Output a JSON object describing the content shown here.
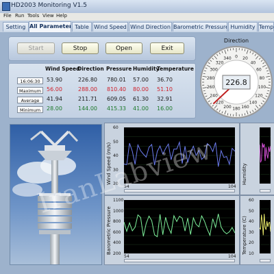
{
  "window": {
    "title": "HD2003 Monitoring V1.5"
  },
  "menu": [
    "File",
    "Run",
    "Tools",
    "View",
    "Help"
  ],
  "tabs": [
    {
      "label": "Setting",
      "active": false
    },
    {
      "label": "All Parameters",
      "active": true
    },
    {
      "label": "Table",
      "active": false
    },
    {
      "label": "Wind Speed",
      "active": false
    },
    {
      "label": "Wind Direction",
      "active": false
    },
    {
      "label": "Barometric Pressure",
      "active": false
    },
    {
      "label": "Humidity",
      "active": false
    },
    {
      "label": "Temp",
      "active": false
    }
  ],
  "buttons": {
    "start": "Start",
    "stop": "Stop",
    "open": "Open",
    "exit": "Exit"
  },
  "table": {
    "headers": [
      "Wind Speed",
      "Direction",
      "Pressure",
      "Humidity",
      "Temperature"
    ],
    "rows": [
      {
        "label": "16:06:30",
        "values": [
          "53.90",
          "226.80",
          "780.01",
          "57.00",
          "36.70"
        ],
        "color": "#1a1a1a"
      },
      {
        "label": "Maximum",
        "values": [
          "56.00",
          "288.00",
          "810.40",
          "80.00",
          "51.10"
        ],
        "color": "#d0202a"
      },
      {
        "label": "Average",
        "values": [
          "41.94",
          "211.71",
          "609.05",
          "61.30",
          "32.91"
        ],
        "color": "#1a1a1a"
      },
      {
        "label": "Minimum",
        "values": [
          "28.00",
          "144.00",
          "415.33",
          "41.00",
          "16.00"
        ],
        "color": "#1e7a2a"
      }
    ]
  },
  "gauge": {
    "title": "Direction",
    "value": "226.8",
    "ticks": [
      "0",
      "20",
      "40",
      "60",
      "80",
      "100",
      "120",
      "140",
      "160",
      "180",
      "200",
      "220",
      "240",
      "260",
      "280",
      "300",
      "320",
      "340"
    ]
  },
  "watermark": "IranLabview",
  "charts": [
    {
      "ylabel": "Wind Speed (m/s)",
      "yticks": [
        "60",
        "50",
        "40",
        "30",
        "20"
      ],
      "xticks": [
        "54",
        "104"
      ],
      "color": "#6c7cf0"
    },
    {
      "ylabel": "Humidity",
      "yticks": [],
      "xticks": [],
      "color": "#d24fd4"
    },
    {
      "ylabel": "Barometric Pressure",
      "yticks": [
        "1100",
        "1000",
        "800",
        "600",
        "400",
        "200"
      ],
      "xticks": [
        "54",
        "104"
      ],
      "color": "#7ef09b"
    },
    {
      "ylabel": "Temperature (C)",
      "yticks": [
        "60",
        "50",
        "40",
        "30",
        "20",
        "10"
      ],
      "xticks": [],
      "color": "#e8e86a"
    }
  ],
  "colors": {
    "accent": "#2a4f86",
    "max": "#d0202a",
    "min": "#1e7a2a"
  }
}
